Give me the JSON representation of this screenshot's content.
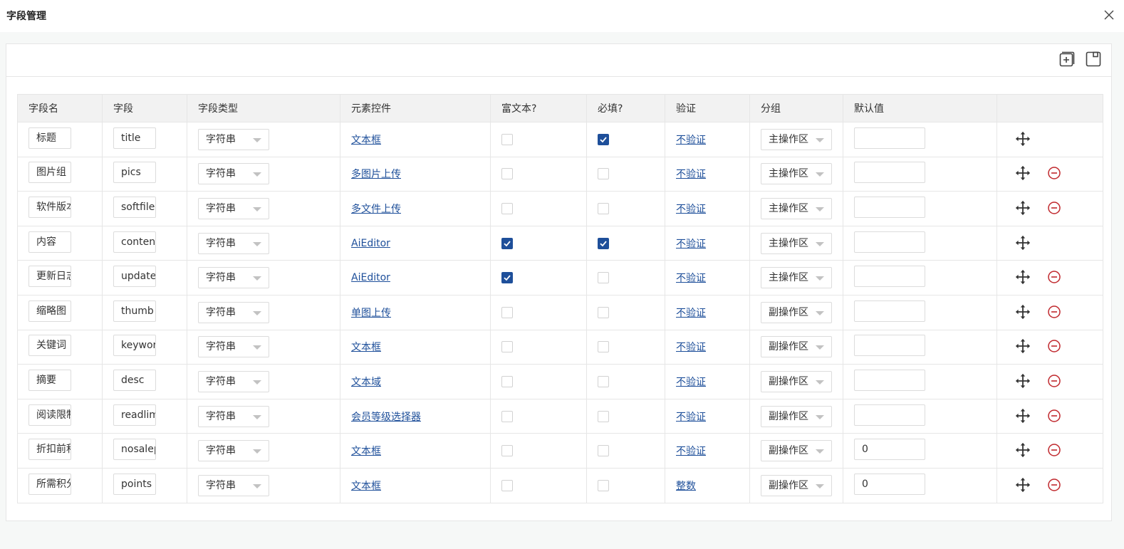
{
  "window": {
    "title": "字段管理"
  },
  "toolbar": {
    "add_icon": "add-window-icon",
    "save_icon": "save-icon"
  },
  "headers": [
    "字段名",
    "字段",
    "字段类型",
    "元素控件",
    "富文本?",
    "必填?",
    "验证",
    "分组",
    "默认值",
    ""
  ],
  "rows": [
    {
      "name": "标题",
      "field": "title",
      "type": "字符串",
      "control": "文本框",
      "richtext": false,
      "required": true,
      "validate": "不验证",
      "group": "主操作区",
      "default": "",
      "deletable": false
    },
    {
      "name": "图片组",
      "field": "pics",
      "type": "字符串",
      "control": "多图片上传",
      "richtext": false,
      "required": false,
      "validate": "不验证",
      "group": "主操作区",
      "default": "",
      "deletable": true
    },
    {
      "name": "软件版本",
      "field": "softfiles",
      "type": "字符串",
      "control": "多文件上传",
      "richtext": false,
      "required": false,
      "validate": "不验证",
      "group": "主操作区",
      "default": "",
      "deletable": true
    },
    {
      "name": "内容",
      "field": "content",
      "type": "字符串",
      "control": "AiEditor",
      "richtext": true,
      "required": true,
      "validate": "不验证",
      "group": "主操作区",
      "default": "",
      "deletable": false
    },
    {
      "name": "更新日志",
      "field": "updatelog",
      "type": "字符串",
      "control": "AiEditor",
      "richtext": true,
      "required": false,
      "validate": "不验证",
      "group": "主操作区",
      "default": "",
      "deletable": true
    },
    {
      "name": "缩略图",
      "field": "thumb",
      "type": "字符串",
      "control": "单图上传",
      "richtext": false,
      "required": false,
      "validate": "不验证",
      "group": "副操作区",
      "default": "",
      "deletable": true
    },
    {
      "name": "关键词",
      "field": "keywords",
      "type": "字符串",
      "control": "文本框",
      "richtext": false,
      "required": false,
      "validate": "不验证",
      "group": "副操作区",
      "default": "",
      "deletable": true
    },
    {
      "name": "摘要",
      "field": "desc",
      "type": "字符串",
      "control": "文本域",
      "richtext": false,
      "required": false,
      "validate": "不验证",
      "group": "副操作区",
      "default": "",
      "deletable": true
    },
    {
      "name": "阅读限制",
      "field": "readlimit",
      "type": "字符串",
      "control": "会员等级选择器",
      "richtext": false,
      "required": false,
      "validate": "不验证",
      "group": "副操作区",
      "default": "",
      "deletable": true
    },
    {
      "name": "折扣前积分",
      "field": "nosalepoints",
      "type": "字符串",
      "control": "文本框",
      "richtext": false,
      "required": false,
      "validate": "不验证",
      "group": "副操作区",
      "default": "0",
      "deletable": true
    },
    {
      "name": "所需积分",
      "field": "points",
      "type": "字符串",
      "control": "文本框",
      "richtext": false,
      "required": false,
      "validate": "整数",
      "group": "副操作区",
      "default": "0",
      "deletable": true
    }
  ],
  "colors": {
    "accent": "#1e4f9a",
    "danger": "#c0282d",
    "border": "#e6e6e6"
  }
}
